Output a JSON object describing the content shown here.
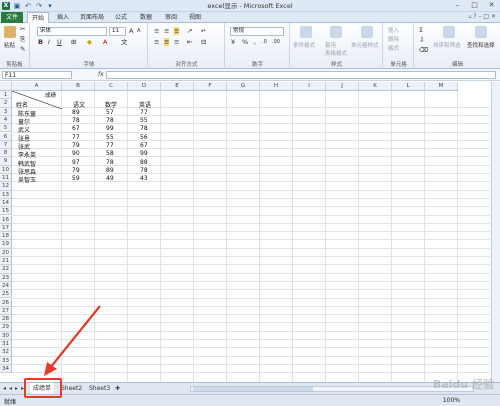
{
  "window": {
    "title": "excel显示 - Microsoft Excel",
    "minimize": "–",
    "restore": "□",
    "close": "✕"
  },
  "ribbon_tabs": [
    "文件",
    "开始",
    "插入",
    "页面布局",
    "公式",
    "数据",
    "审阅",
    "视图"
  ],
  "ribbon": {
    "clipboard": {
      "label": "剪贴板",
      "paste": "粘贴"
    },
    "font": {
      "label": "字体",
      "name": "宋体",
      "size": "11"
    },
    "alignment": {
      "label": "对齐方式"
    },
    "number": {
      "label": "数字",
      "format": "常规"
    },
    "styles": {
      "label": "样式",
      "cond_format": "条件格式",
      "table_format": "套用\n表格格式",
      "cell_style": "单元格样式"
    },
    "cells": {
      "label": "单元格",
      "insert": "插入",
      "delete": "删除",
      "format": "格式"
    },
    "editing": {
      "label": "编辑",
      "sort": "排序和筛选",
      "find": "查找和选择"
    }
  },
  "formula_bar": {
    "name_box": "F11",
    "fx": "fx",
    "value": ""
  },
  "columns": [
    "A",
    "B",
    "C",
    "D",
    "E",
    "F",
    "G",
    "H",
    "I",
    "J",
    "K",
    "L",
    "M"
  ],
  "rows": [
    "1",
    "2",
    "3",
    "4",
    "5",
    "6",
    "7",
    "8",
    "9",
    "10",
    "11",
    "12",
    "13",
    "14",
    "15",
    "16",
    "17",
    "18",
    "19",
    "20",
    "21",
    "22",
    "23",
    "24",
    "25",
    "26",
    "27",
    "28",
    "29",
    "30",
    "31",
    "32",
    "33",
    "34"
  ],
  "table": {
    "a1_top": "成绩",
    "a1_bottom": "姓名",
    "headers": [
      "语文",
      "数学",
      "英语"
    ],
    "records": [
      [
        "陈东童",
        "89",
        "57",
        "77"
      ],
      [
        "童尔",
        "78",
        "78",
        "55"
      ],
      [
        "武义",
        "67",
        "99",
        "78"
      ],
      [
        "张恩",
        "77",
        "55",
        "56"
      ],
      [
        "张武",
        "79",
        "77",
        "67"
      ],
      [
        "李永英",
        "90",
        "58",
        "99"
      ],
      [
        "韩武智",
        "97",
        "78",
        "88"
      ],
      [
        "张思淼",
        "79",
        "89",
        "78"
      ],
      [
        "吴智玉",
        "59",
        "49",
        "43"
      ]
    ]
  },
  "sheets": [
    "成绩单",
    "Sheet2",
    "Sheet3"
  ],
  "status": {
    "ready": "就绪",
    "zoom": "100%"
  },
  "watermark": "Baidu 经验",
  "colors": {
    "file_tab": "#2a7a3f",
    "highlight": "#e23b2a"
  }
}
